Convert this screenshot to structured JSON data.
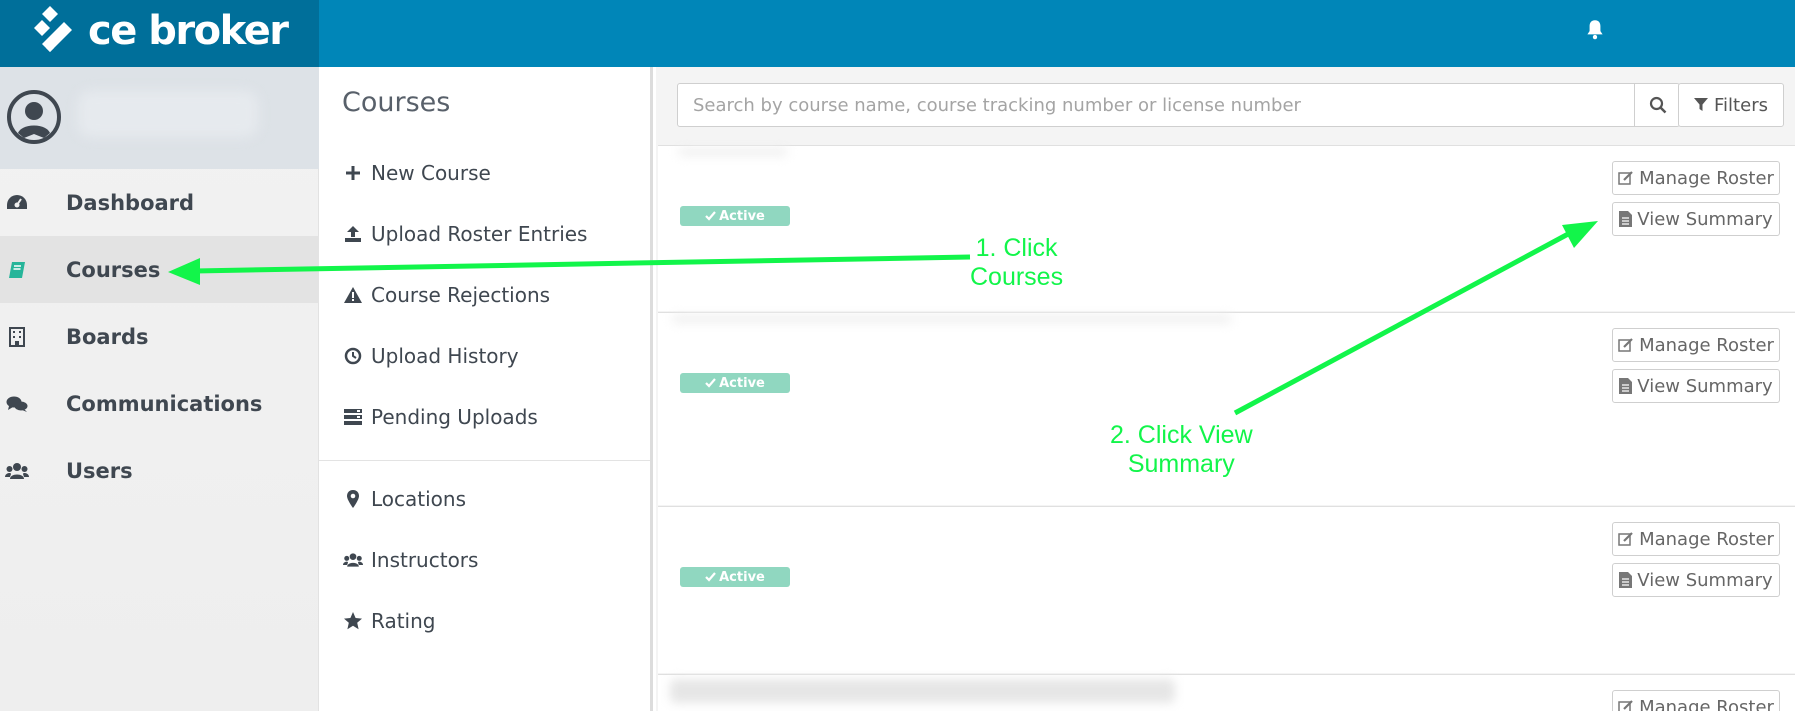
{
  "brand": {
    "name": "ce broker"
  },
  "nav": {
    "items": [
      {
        "label": "Dashboard"
      },
      {
        "label": "Courses"
      },
      {
        "label": "Boards"
      },
      {
        "label": "Communications"
      },
      {
        "label": "Users"
      }
    ]
  },
  "submenu": {
    "title": "Courses",
    "items": [
      {
        "label": "New Course"
      },
      {
        "label": "Upload Roster Entries"
      },
      {
        "label": "Course Rejections"
      },
      {
        "label": "Upload History"
      },
      {
        "label": "Pending Uploads"
      },
      {
        "label": "Locations"
      },
      {
        "label": "Instructors"
      },
      {
        "label": "Rating"
      }
    ]
  },
  "search": {
    "placeholder": "Search by course name, course tracking number or license number",
    "filters_label": "Filters"
  },
  "courses": [
    {
      "status": "Active",
      "manage_label": "Manage Roster",
      "summary_label": "View Summary"
    },
    {
      "status": "Active",
      "manage_label": "Manage Roster",
      "summary_label": "View Summary"
    },
    {
      "status": "Active",
      "manage_label": "Manage Roster",
      "summary_label": "View Summary"
    },
    {
      "manage_label": "Manage Roster"
    }
  ],
  "annotations": {
    "step1": "1. Click\nCourses",
    "step2": "2. Click View\nSummary",
    "color": "#12f54a"
  },
  "colors": {
    "topbar": "#0086b8",
    "brand_bg": "#006f9a",
    "status_active": "#90d7c0",
    "courses_icon": "#26b59a"
  }
}
